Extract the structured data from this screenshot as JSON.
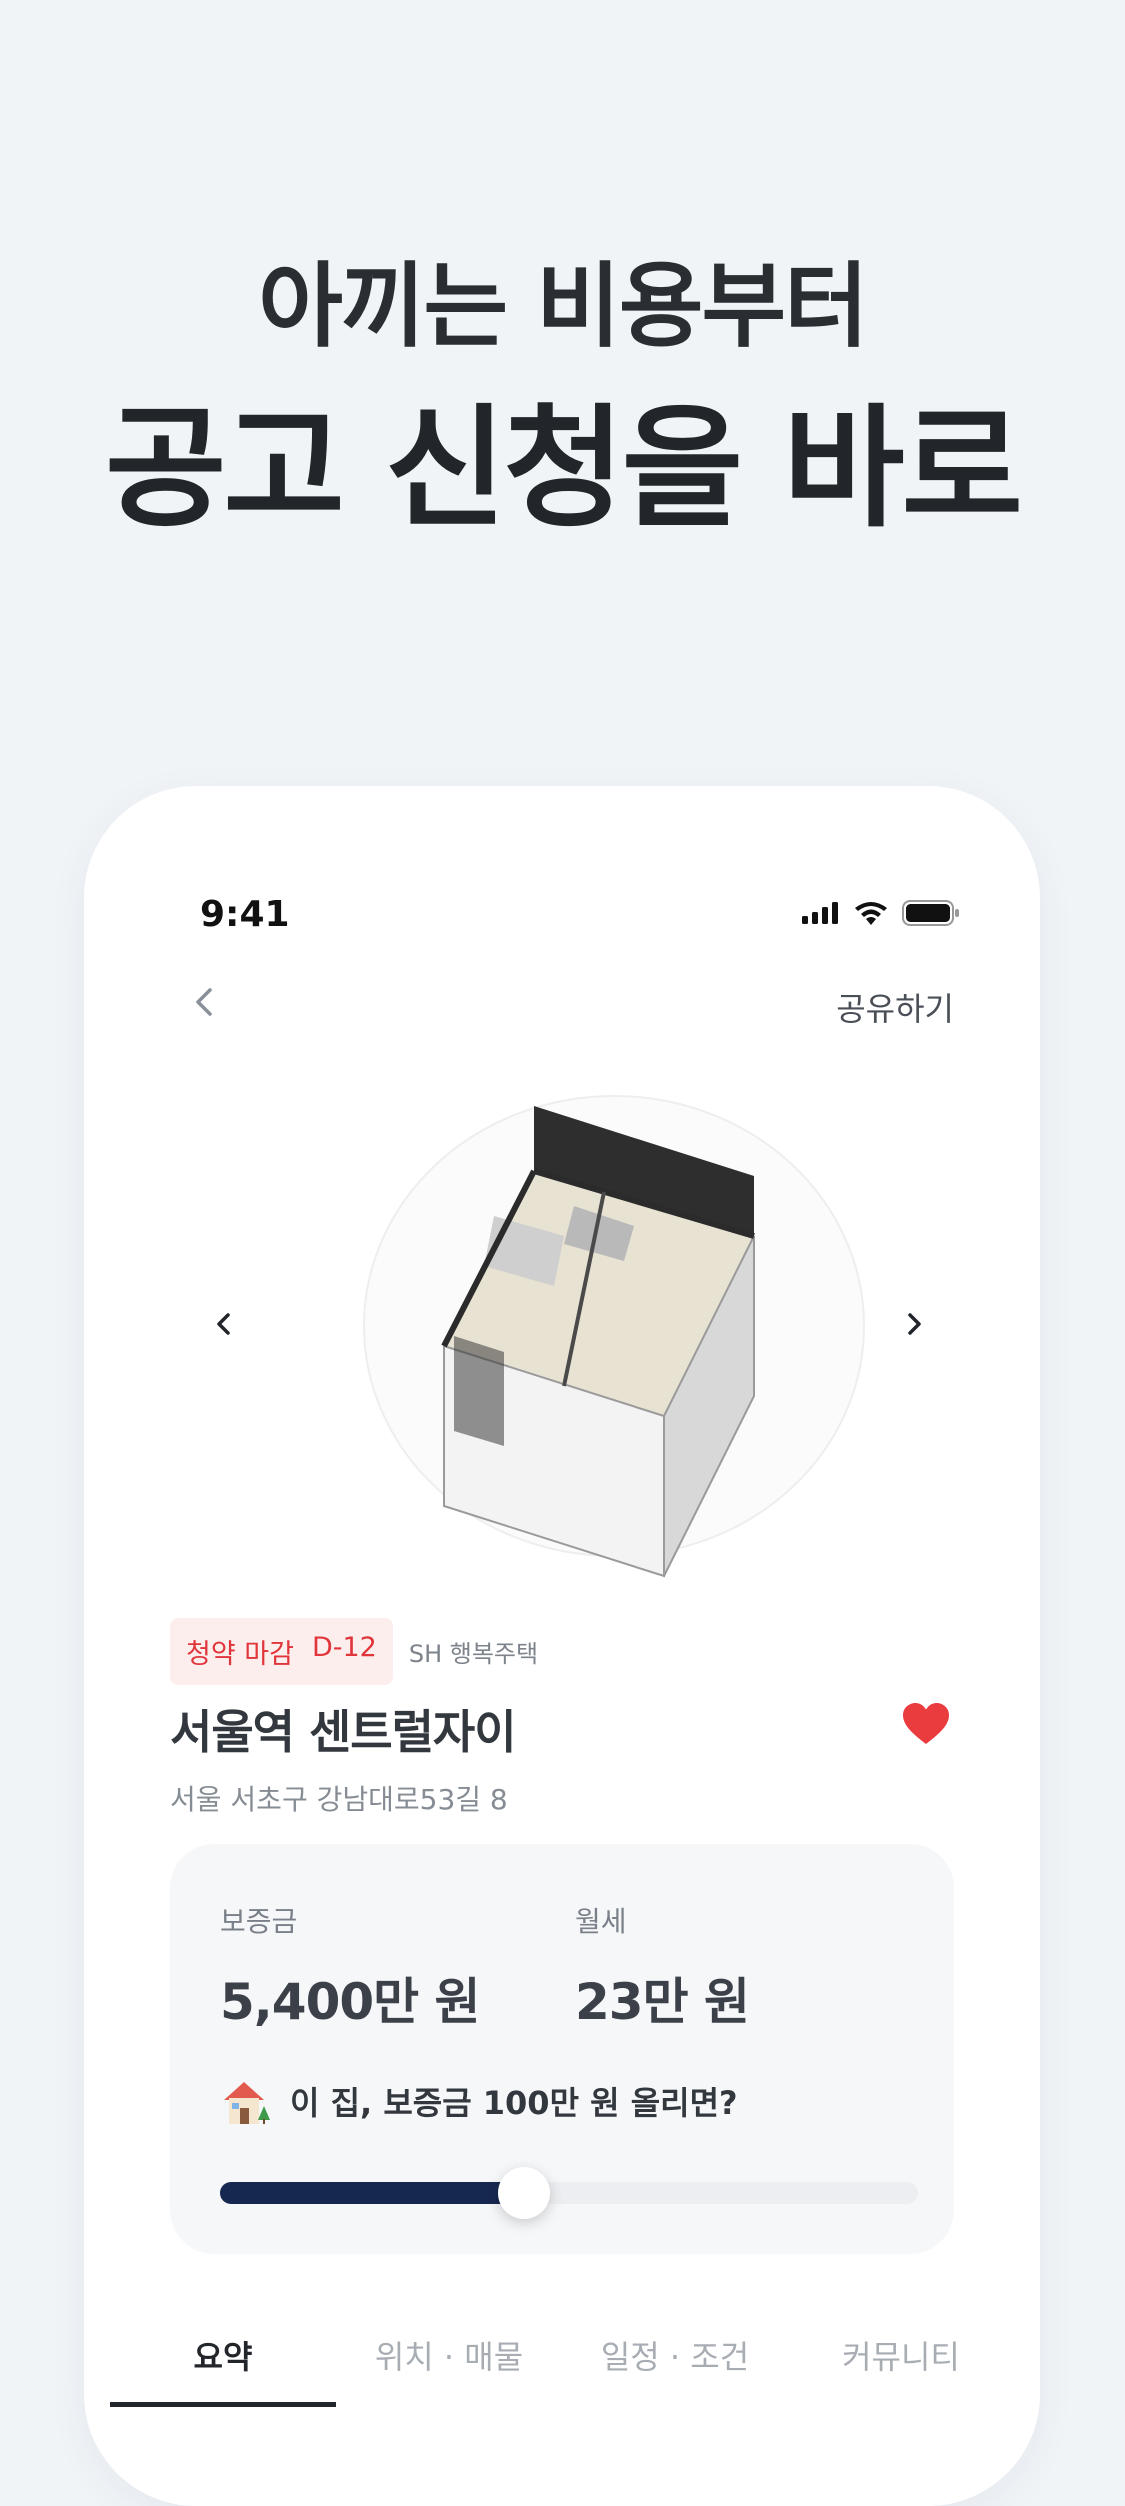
{
  "promo": {
    "line1": "아끼는 비용부터",
    "line2": "공고 신청을 바로"
  },
  "status_bar": {
    "time": "9:41",
    "icons": [
      "signal-icon",
      "wifi-icon",
      "battery-icon"
    ]
  },
  "nav": {
    "back_icon": "chevron-left-icon",
    "share_label": "공유하기"
  },
  "gallery": {
    "prev_icon": "chevron-left-icon",
    "next_icon": "chevron-right-icon",
    "image": "3d-floorplan"
  },
  "listing": {
    "badge_status": "청약 마감",
    "badge_dday": "D-12",
    "provider": "SH 행복주택",
    "title": "서울역 센트럴자이",
    "address": "서울 서초구 강남대로53길 8",
    "favorited": true
  },
  "price": {
    "deposit_label": "보증금",
    "deposit_value": "5,400만 원",
    "rent_label": "월세",
    "rent_value": "23만 원",
    "simulation_text": "이 집, 보증금 100만 원 올리면?",
    "slider_level": 0.435
  },
  "tabs": [
    {
      "label": "요약",
      "active": true
    },
    {
      "label": "위치 · 매물",
      "active": false
    },
    {
      "label": "일정 · 조건",
      "active": false
    },
    {
      "label": "커뮤니티",
      "active": false
    }
  ],
  "colors": {
    "background": "#f1f4f7",
    "accent_red": "#e0353b",
    "slider_fill": "#172850"
  }
}
